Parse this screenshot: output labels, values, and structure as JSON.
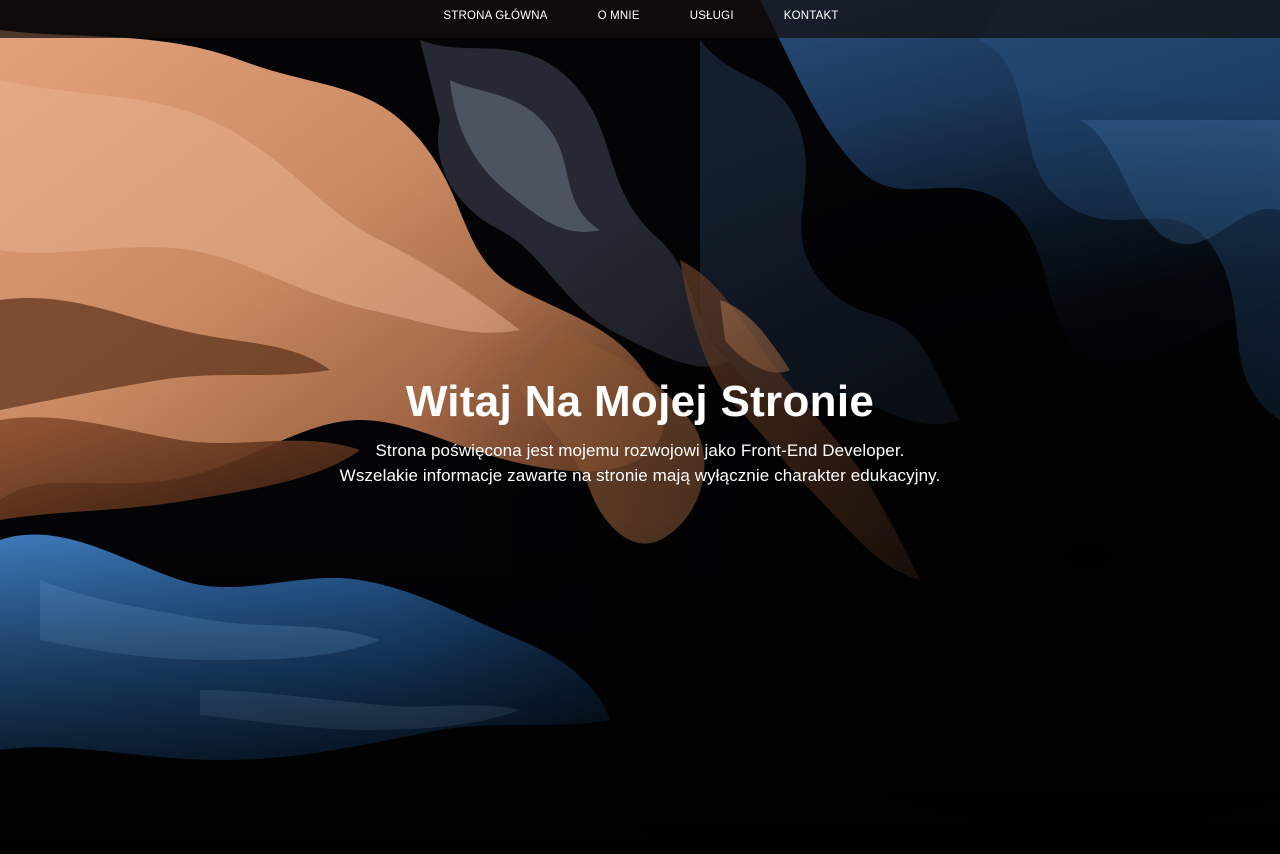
{
  "nav": {
    "items": [
      {
        "label": "STRONA GŁÓWNA"
      },
      {
        "label": "O MNIE"
      },
      {
        "label": "USŁUGI"
      },
      {
        "label": "KONTAKT"
      }
    ]
  },
  "hero": {
    "title": "Witaj Na Mojej Stronie",
    "subtitle_line1": "Strona poświęcona jest mojemu rozwojowi jako Front-End Developer.",
    "subtitle_line2": "Wszelakie informacje zawarte na stronie mają wyłącznie charakter edukacyjny."
  },
  "colors": {
    "copper": "#c98a63",
    "deep_blue": "#1d4f86",
    "background": "#030305",
    "text": "#ffffff"
  }
}
